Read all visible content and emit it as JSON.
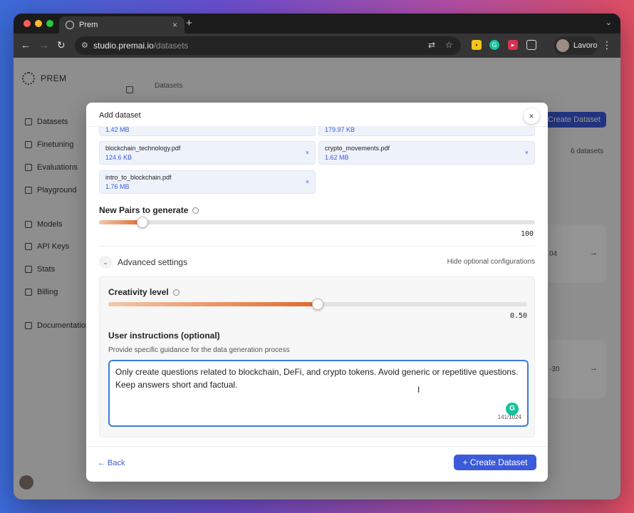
{
  "browser": {
    "tab_title": "Prem",
    "tab_close": "×",
    "new_tab": "+",
    "url_host": "studio.premai.io",
    "url_path": "/datasets",
    "profile_name": "Lavoro"
  },
  "sidebar": {
    "brand": "PREM",
    "items": [
      {
        "label": "Datasets"
      },
      {
        "label": "Finetuning"
      },
      {
        "label": "Evaluations"
      },
      {
        "label": "Playground"
      },
      {
        "label": "Models"
      },
      {
        "label": "API Keys"
      },
      {
        "label": "Stats"
      },
      {
        "label": "Billing"
      },
      {
        "label": "Documentation"
      }
    ]
  },
  "background": {
    "breadcrumb": "Datasets",
    "create_button": "Create Dataset",
    "dataset_count": "6 datasets",
    "card_dates": [
      "04",
      "-30"
    ]
  },
  "modal": {
    "title": "Add dataset",
    "close": "×",
    "files": [
      {
        "name": "",
        "size": "1.42 MB"
      },
      {
        "name": "",
        "size": "179.97 KB"
      },
      {
        "name": "blockchain_technology.pdf",
        "size": "124.6 KB"
      },
      {
        "name": "crypto_movements.pdf",
        "size": "1.62 MB"
      },
      {
        "name": "intro_to_blockchain.pdf",
        "size": "1.76 MB"
      }
    ],
    "remove_glyph": "×",
    "pairs_label": "New Pairs to generate",
    "pairs_value": "100",
    "pairs_fraction": 0.1,
    "advanced_label": "Advanced settings",
    "advanced_toggle": "Hide optional configurations",
    "creativity_label": "Creativity level",
    "creativity_value": "0.50",
    "creativity_fraction": 0.5,
    "instructions_label": "User instructions (optional)",
    "instructions_help": "Provide specific guidance for the data generation process",
    "instructions_text": "Only create questions related to blockchain, DeFi, and crypto tokens. Avoid generic or repetitive questions. Keep answers short and factual.",
    "instructions_counter": "141/1024",
    "back_label": "← Back",
    "create_label": "+  Create Dataset"
  },
  "colors": {
    "accent": "#3b5bdb",
    "slider_fill": "#e0672c",
    "textarea_focus": "#3b7be0"
  }
}
